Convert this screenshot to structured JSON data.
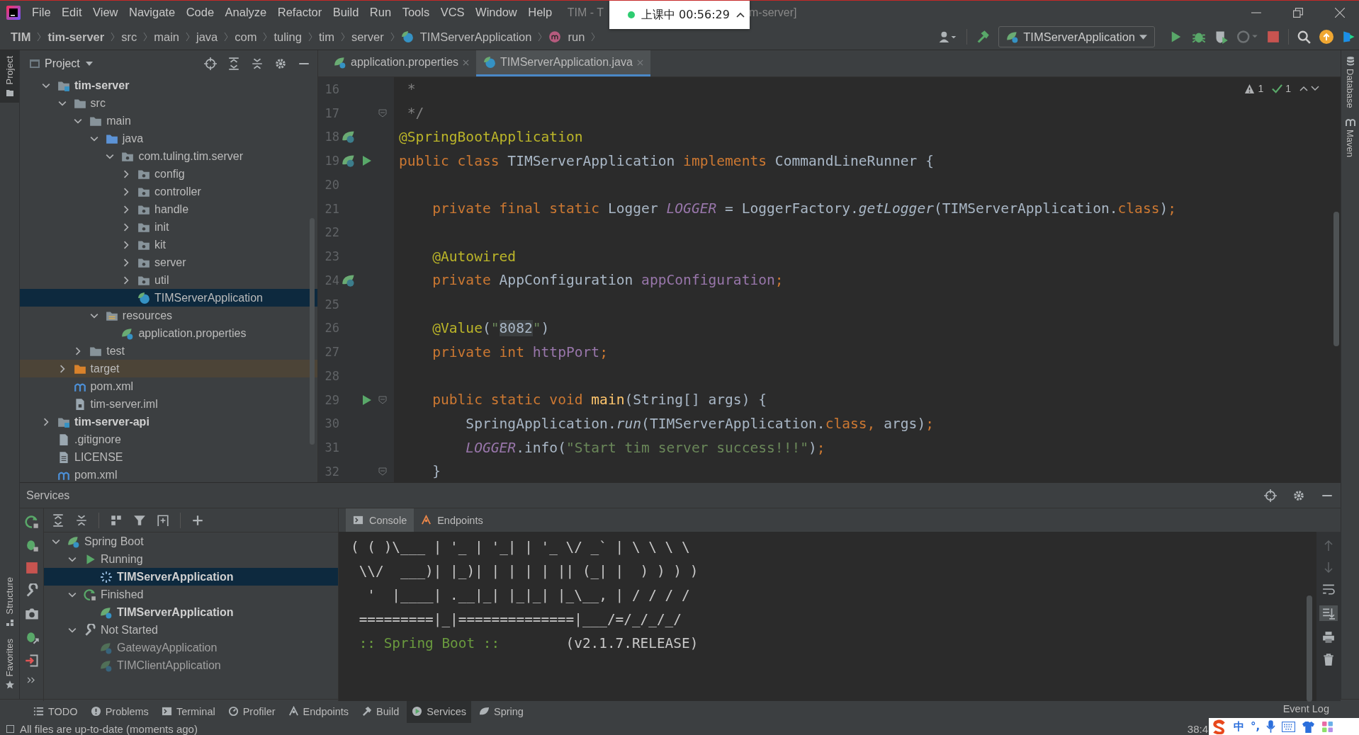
{
  "window": {
    "title_parts": [
      "TIM - T",
      "m-server]"
    ]
  },
  "menu": [
    "File",
    "Edit",
    "View",
    "Navigate",
    "Code",
    "Analyze",
    "Refactor",
    "Build",
    "Run",
    "Tools",
    "VCS",
    "Window",
    "Help"
  ],
  "recording": {
    "label": "上课中 00:56:29"
  },
  "breadcrumbs": [
    {
      "label": "TIM",
      "kind": "bold"
    },
    {
      "label": "tim-server",
      "kind": "bold"
    },
    {
      "label": "src",
      "kind": "plain"
    },
    {
      "label": "main",
      "kind": "plain"
    },
    {
      "label": "java",
      "kind": "plain"
    },
    {
      "label": "com",
      "kind": "plain"
    },
    {
      "label": "tuling",
      "kind": "plain"
    },
    {
      "label": "tim",
      "kind": "plain"
    },
    {
      "label": "server",
      "kind": "plain"
    },
    {
      "label": "TIMServerApplication",
      "kind": "class"
    },
    {
      "label": "run",
      "kind": "method"
    }
  ],
  "run_config": {
    "label": "TIMServerApplication"
  },
  "left_tool_windows_top": [
    {
      "label": "Project",
      "selected": true
    }
  ],
  "left_tool_windows_bottom": [
    {
      "label": "Structure",
      "selected": false
    },
    {
      "label": "Favorites",
      "selected": false
    }
  ],
  "right_tool_windows": [
    "Database",
    "Maven"
  ],
  "project": {
    "title": "Project",
    "tree": [
      {
        "label": "tim-server",
        "kind": "module",
        "expanded": true,
        "selected": false,
        "children": [
          {
            "label": "src",
            "kind": "folder",
            "expanded": true,
            "selected": false,
            "children": [
              {
                "label": "main",
                "kind": "folder",
                "expanded": true,
                "selected": false,
                "children": [
                  {
                    "label": "java",
                    "kind": "source",
                    "expanded": true,
                    "selected": false,
                    "children": [
                      {
                        "label": "com.tuling.tim.server",
                        "kind": "package",
                        "expanded": true,
                        "selected": false,
                        "children": [
                          {
                            "label": "config",
                            "kind": "package",
                            "expanded": false,
                            "selected": false
                          },
                          {
                            "label": "controller",
                            "kind": "package",
                            "expanded": false,
                            "selected": false
                          },
                          {
                            "label": "handle",
                            "kind": "package",
                            "expanded": false,
                            "selected": false
                          },
                          {
                            "label": "init",
                            "kind": "package",
                            "expanded": false,
                            "selected": false
                          },
                          {
                            "label": "kit",
                            "kind": "package",
                            "expanded": false,
                            "selected": false
                          },
                          {
                            "label": "server",
                            "kind": "package",
                            "expanded": false,
                            "selected": false
                          },
                          {
                            "label": "util",
                            "kind": "package",
                            "expanded": false,
                            "selected": false
                          },
                          {
                            "label": "TIMServerApplication",
                            "kind": "class",
                            "selected": true
                          }
                        ]
                      }
                    ]
                  },
                  {
                    "label": "resources",
                    "kind": "resources",
                    "expanded": true,
                    "selected": false,
                    "children": [
                      {
                        "label": "application.properties",
                        "kind": "properties",
                        "selected": false
                      }
                    ]
                  }
                ]
              },
              {
                "label": "test",
                "kind": "folder",
                "expanded": false,
                "selected": false
              }
            ]
          },
          {
            "label": "target",
            "kind": "excluded",
            "expanded": false,
            "selected": false
          },
          {
            "label": "pom.xml",
            "kind": "maven",
            "selected": false
          },
          {
            "label": "tim-server.iml",
            "kind": "iml",
            "selected": false
          }
        ]
      },
      {
        "label": "tim-server-api",
        "kind": "module",
        "expanded": false,
        "selected": false
      },
      {
        "label": ".gitignore",
        "kind": "gitignore",
        "selected": false
      },
      {
        "label": "LICENSE",
        "kind": "text",
        "selected": false
      },
      {
        "label": "pom.xml",
        "kind": "maven",
        "selected": false
      }
    ]
  },
  "editor": {
    "tabs": [
      {
        "label": "application.properties",
        "kind": "properties",
        "selected": false
      },
      {
        "label": "TIMServerApplication.java",
        "kind": "class",
        "selected": true
      }
    ],
    "inspections": {
      "warnings": "1",
      "passed": "1"
    },
    "lines": [
      {
        "num": "16",
        "code": [
          {
            "kind": "comment",
            "t": " *"
          }
        ]
      },
      {
        "num": "17",
        "gutter": [
          {
            "kind": "fold"
          }
        ],
        "code": [
          {
            "kind": "comment",
            "t": " */"
          }
        ]
      },
      {
        "num": "18",
        "gutter": [
          {
            "kind": "bean"
          }
        ],
        "code": [
          {
            "kind": "ann",
            "t": "@SpringBootApplication"
          }
        ]
      },
      {
        "num": "19",
        "gutter": [
          {
            "kind": "bean"
          },
          {
            "kind": "run"
          }
        ],
        "code": [
          {
            "kind": "kw",
            "t": "public class"
          },
          {
            "kind": "plain",
            "t": " TIMServerApplication "
          },
          {
            "kind": "kw",
            "t": "implements"
          },
          {
            "kind": "plain",
            "t": " CommandLineRunner {"
          }
        ]
      },
      {
        "num": "20"
      },
      {
        "num": "21",
        "code": [
          {
            "kind": "kw",
            "t": "    private final static"
          },
          {
            "kind": "plain",
            "t": " Logger "
          },
          {
            "kind": "sfield",
            "t": "LOGGER"
          },
          {
            "kind": "plain",
            "t": " = LoggerFactory."
          },
          {
            "kind": "smethod",
            "t": "getLogger"
          },
          {
            "kind": "plain",
            "t": "(TIMServerApplication."
          },
          {
            "kind": "kw",
            "t": "class"
          },
          {
            "kind": "plain",
            "t": ")"
          },
          {
            "kind": "kw",
            "t": ";"
          }
        ]
      },
      {
        "num": "22"
      },
      {
        "num": "23",
        "code": [
          {
            "kind": "ann",
            "t": "    @Autowired"
          }
        ]
      },
      {
        "num": "24",
        "gutter": [
          {
            "kind": "bean"
          }
        ],
        "code": [
          {
            "kind": "kw",
            "t": "    private"
          },
          {
            "kind": "plain",
            "t": " AppConfiguration "
          },
          {
            "kind": "field",
            "t": "appConfiguration"
          },
          {
            "kind": "kw",
            "t": ";"
          }
        ]
      },
      {
        "num": "25"
      },
      {
        "num": "26",
        "code": [
          {
            "kind": "ann",
            "t": "    @Value"
          },
          {
            "kind": "plain",
            "t": "("
          },
          {
            "kind": "string",
            "t": "\""
          },
          {
            "kind": "injected",
            "t": "8082"
          },
          {
            "kind": "string",
            "t": "\""
          },
          {
            "kind": "plain",
            "t": ")"
          }
        ]
      },
      {
        "num": "27",
        "code": [
          {
            "kind": "kw",
            "t": "    private int"
          },
          {
            "kind": "field",
            "t": " httpPort"
          },
          {
            "kind": "kw",
            "t": ";"
          }
        ]
      },
      {
        "num": "28"
      },
      {
        "num": "29",
        "gutter": [
          {
            "kind": "run"
          },
          {
            "kind": "fold"
          }
        ],
        "code": [
          {
            "kind": "kw",
            "t": "    public static void"
          },
          {
            "kind": "mdecl",
            "t": " main"
          },
          {
            "kind": "plain",
            "t": "(String[] args) {"
          }
        ]
      },
      {
        "num": "30",
        "code": [
          {
            "kind": "plain",
            "t": "        SpringApplication."
          },
          {
            "kind": "smethod",
            "t": "run"
          },
          {
            "kind": "plain",
            "t": "(TIMServerApplication."
          },
          {
            "kind": "kw",
            "t": "class,"
          },
          {
            "kind": "plain",
            "t": " args)"
          },
          {
            "kind": "kw",
            "t": ";"
          }
        ]
      },
      {
        "num": "31",
        "code": [
          {
            "kind": "sfield",
            "t": "        LOGGER"
          },
          {
            "kind": "plain",
            "t": ".info("
          },
          {
            "kind": "string",
            "t": "\"Start tim server success!!!\""
          },
          {
            "kind": "plain",
            "t": ")"
          },
          {
            "kind": "kw",
            "t": ";"
          }
        ]
      },
      {
        "num": "32",
        "gutter": [
          {
            "kind": "fold"
          }
        ],
        "code": [
          {
            "kind": "plain",
            "t": "    }"
          }
        ]
      }
    ]
  },
  "services": {
    "title": "Services",
    "tree": [
      {
        "label": "Spring Boot",
        "kind": "spring",
        "expanded": true,
        "selected": false,
        "children": [
          {
            "label": "Running",
            "kind": "running",
            "expanded": true,
            "selected": false,
            "children": [
              {
                "label": "TIMServerApplication",
                "kind": "app-running",
                "selected": true
              }
            ]
          },
          {
            "label": "Finished",
            "kind": "finished",
            "expanded": true,
            "selected": false,
            "children": [
              {
                "label": "TIMServerApplication",
                "kind": "app-finished",
                "selected": false
              }
            ]
          },
          {
            "label": "Not Started",
            "kind": "not-started",
            "expanded": true,
            "selected": false,
            "children": [
              {
                "label": "GatewayApplication",
                "kind": "app-idle",
                "selected": false
              },
              {
                "label": "TIMClientApplication",
                "kind": "app-idle",
                "selected": false
              }
            ]
          }
        ]
      }
    ],
    "tabs": [
      {
        "label": "Console",
        "kind": "console",
        "selected": true
      },
      {
        "label": "Endpoints",
        "kind": "endpoints",
        "selected": false
      }
    ],
    "console": [
      {
        "segments": [
          {
            "kind": "plain",
            "t": "( ( )\\___ | '_ | '_| | '_ \\/ _` | \\ \\ \\ \\"
          }
        ]
      },
      {
        "segments": [
          {
            "kind": "plain",
            "t": " \\\\/  ___)| |_)| | | | | || (_| |  ) ) ) )"
          }
        ]
      },
      {
        "segments": [
          {
            "kind": "plain",
            "t": "  '  |____| .__|_| |_|_| |_\\__, | / / / /"
          }
        ]
      },
      {
        "segments": [
          {
            "kind": "plain",
            "t": " =========|_|==============|___/=/_/_/_/"
          }
        ]
      },
      {
        "segments": [
          {
            "kind": "green",
            "t": " :: Spring Boot ::"
          },
          {
            "kind": "plain",
            "t": "        (v2.1.7.RELEASE)"
          }
        ]
      }
    ]
  },
  "tool_windows": [
    {
      "label": "TODO",
      "kind": "todo",
      "selected": false
    },
    {
      "label": "Problems",
      "kind": "problems",
      "selected": false
    },
    {
      "label": "Terminal",
      "kind": "terminal",
      "selected": false
    },
    {
      "label": "Profiler",
      "kind": "profiler",
      "selected": false
    },
    {
      "label": "Endpoints",
      "kind": "endpoints",
      "selected": false
    },
    {
      "label": "Build",
      "kind": "build",
      "selected": false
    },
    {
      "label": "Services",
      "kind": "services",
      "selected": true
    },
    {
      "label": "Spring",
      "kind": "spring",
      "selected": false
    }
  ],
  "status_bar": {
    "message": "All files are up-to-date (moments ago)",
    "position": "38:4",
    "event_log": "Event Log"
  },
  "tray": {
    "language": "中",
    "punctuation": "°,"
  }
}
